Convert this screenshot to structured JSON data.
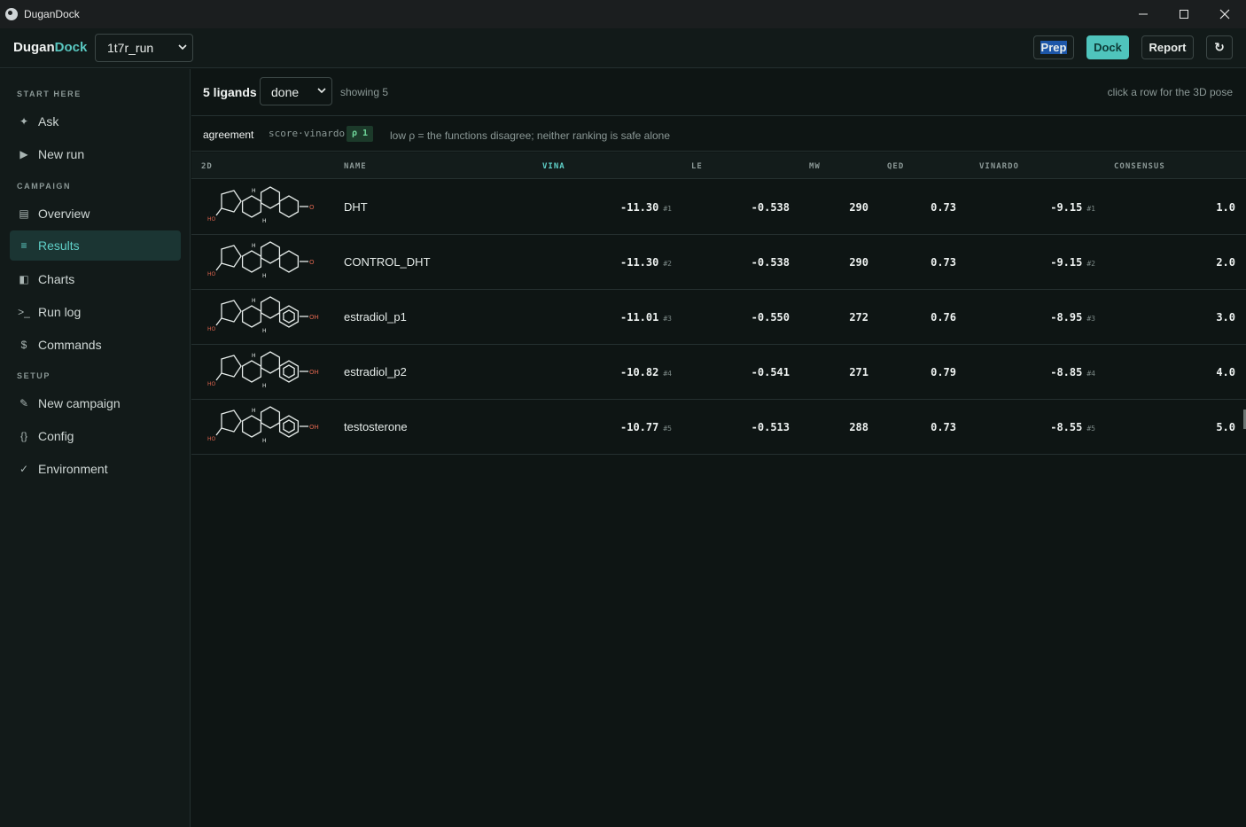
{
  "window": {
    "title": "DuganDock",
    "min_icon": "minimize-icon",
    "max_icon": "maximize-icon",
    "close_icon": "close-icon"
  },
  "appbar": {
    "brand_prefix": "Dugan",
    "brand_accent": "Dock",
    "run_select": "1t7r_run",
    "buttons": {
      "prep": "Prep",
      "dock": "Dock",
      "report": "Report",
      "refresh": "↻"
    }
  },
  "sidebar": {
    "sections": {
      "start": "START HERE",
      "campaign": "CAMPAIGN",
      "setup": "SETUP"
    },
    "items": [
      {
        "label": "Ask",
        "icon": "✦"
      },
      {
        "label": "New run",
        "icon": "▶"
      },
      {
        "label": "Overview",
        "icon": "▤"
      },
      {
        "label": "Results",
        "icon": "≡"
      },
      {
        "label": "Charts",
        "icon": "◧"
      },
      {
        "label": "Run log",
        "icon": ">_"
      },
      {
        "label": "Commands",
        "icon": "$"
      },
      {
        "label": "New campaign",
        "icon": "✎"
      },
      {
        "label": "Config",
        "icon": "{}"
      },
      {
        "label": "Environment",
        "icon": "✓"
      }
    ]
  },
  "filter": {
    "count": "5 ligands",
    "status": "done",
    "showing": "showing 5",
    "hint": "click a row for the 3D pose"
  },
  "agreement": {
    "label": "agreement",
    "pair": "score·vinardo",
    "rho": "ρ 1",
    "note": "low ρ = the functions disagree; neither ranking is safe alone"
  },
  "columns": {
    "c2d": "2D",
    "name": "NAME",
    "vina": "VINA",
    "le": "LE",
    "mw": "MW",
    "qed": "QED",
    "vinardo": "VINARDO",
    "consensus": "CONSENSUS"
  },
  "rows": [
    {
      "name": "DHT",
      "vina": "-11.30",
      "vina_rank": "#1",
      "le": "-0.538",
      "mw": "290",
      "qed": "0.73",
      "vinardo": "-9.15",
      "vinardo_rank": "#1",
      "consensus": "1.0"
    },
    {
      "name": "CONTROL_DHT",
      "vina": "-11.30",
      "vina_rank": "#2",
      "le": "-0.538",
      "mw": "290",
      "qed": "0.73",
      "vinardo": "-9.15",
      "vinardo_rank": "#2",
      "consensus": "2.0"
    },
    {
      "name": "estradiol_p1",
      "vina": "-11.01",
      "vina_rank": "#3",
      "le": "-0.550",
      "mw": "272",
      "qed": "0.76",
      "vinardo": "-8.95",
      "vinardo_rank": "#3",
      "consensus": "3.0"
    },
    {
      "name": "estradiol_p2",
      "vina": "-10.82",
      "vina_rank": "#4",
      "le": "-0.541",
      "mw": "271",
      "qed": "0.79",
      "vinardo": "-8.85",
      "vinardo_rank": "#4",
      "consensus": "4.0"
    },
    {
      "name": "testosterone",
      "vina": "-10.77",
      "vina_rank": "#5",
      "le": "-0.513",
      "mw": "288",
      "qed": "0.73",
      "vinardo": "-8.55",
      "vinardo_rank": "#5",
      "consensus": "5.0"
    }
  ],
  "structure_labels": {
    "hydroxyl": "HO",
    "hydrogen": "H",
    "oxygen": "O",
    "phenol": "OH"
  }
}
